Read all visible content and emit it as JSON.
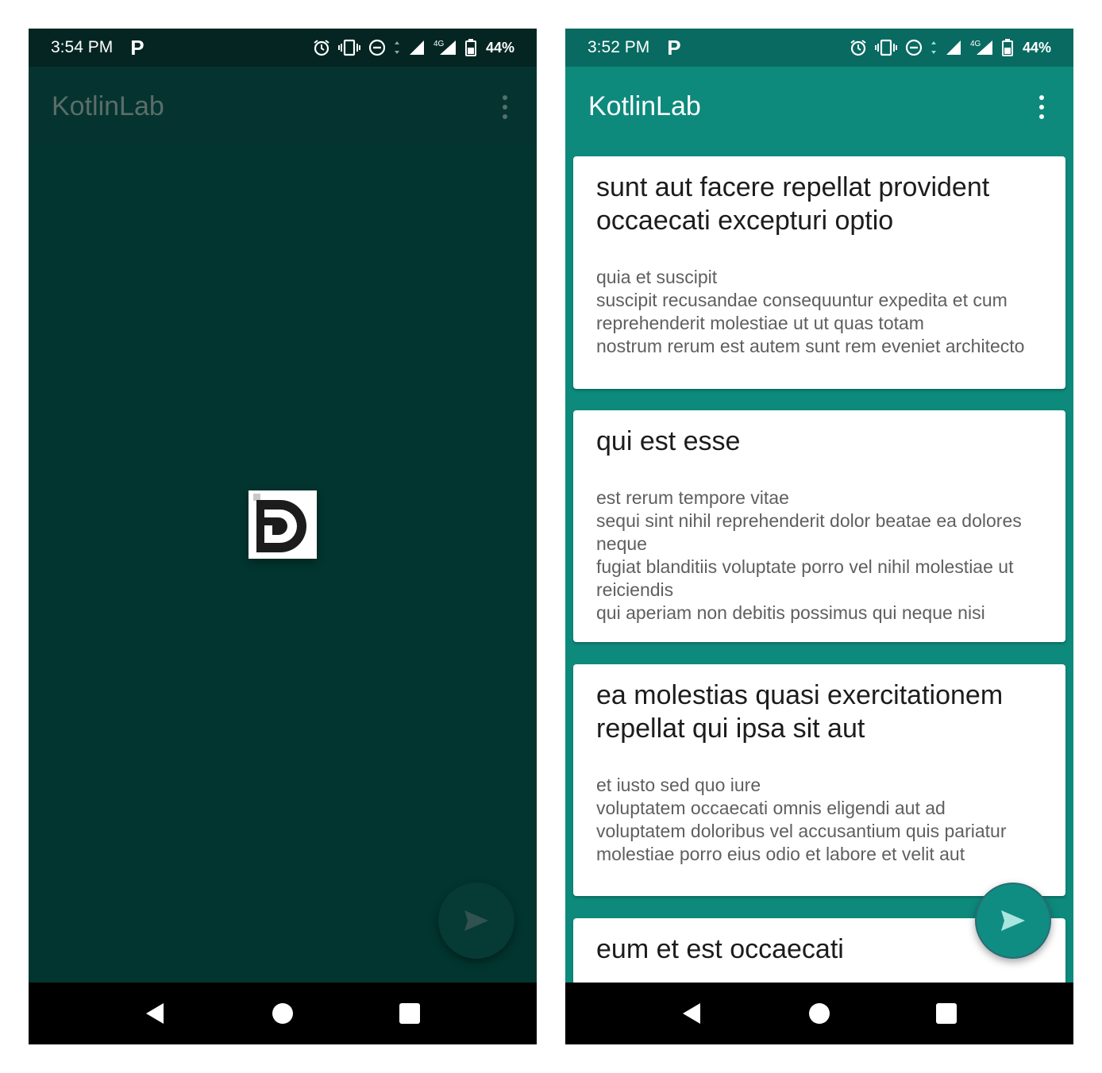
{
  "left_screen": {
    "status_bar": {
      "time": "3:54 PM",
      "notification_icon": "p",
      "battery": "44%",
      "network": "4G"
    },
    "app_bar": {
      "title": "KotlinLab",
      "menu_icon": "more-vert-icon"
    },
    "splash": {
      "logo_icon": "d-logo-icon"
    },
    "fab": {
      "icon": "send-icon"
    }
  },
  "right_screen": {
    "status_bar": {
      "time": "3:52 PM",
      "notification_icon": "p",
      "battery": "44%",
      "network": "4G"
    },
    "app_bar": {
      "title": "KotlinLab",
      "menu_icon": "more-vert-icon"
    },
    "posts": [
      {
        "title": "sunt aut facere repellat provident occaecati excepturi optio",
        "body": "quia et suscipit\nsuscipit recusandae consequuntur expedita et cum reprehenderit molestiae ut ut quas totam\nnostrum rerum est autem sunt rem eveniet architecto"
      },
      {
        "title": "qui est esse",
        "body": "est rerum tempore vitae\nsequi sint nihil reprehenderit dolor beatae ea dolores neque\nfugiat blanditiis voluptate porro vel nihil molestiae ut reiciendis\nqui aperiam non debitis possimus qui neque nisi"
      },
      {
        "title": "ea molestias quasi exercitationem repellat qui ipsa sit aut",
        "body": "et iusto sed quo iure\nvoluptatem occaecati omnis eligendi aut ad\nvoluptatem doloribus vel accusantium quis pariatur\nmolestiae porro eius odio et labore et velit aut"
      },
      {
        "title": "eum et est occaecati",
        "body": ""
      }
    ],
    "fab": {
      "icon": "send-icon"
    }
  },
  "colors": {
    "primary": "#0d8a7c",
    "primary_dark": "#086a60",
    "splash_bg": "#02352f",
    "card_bg": "#ffffff"
  }
}
